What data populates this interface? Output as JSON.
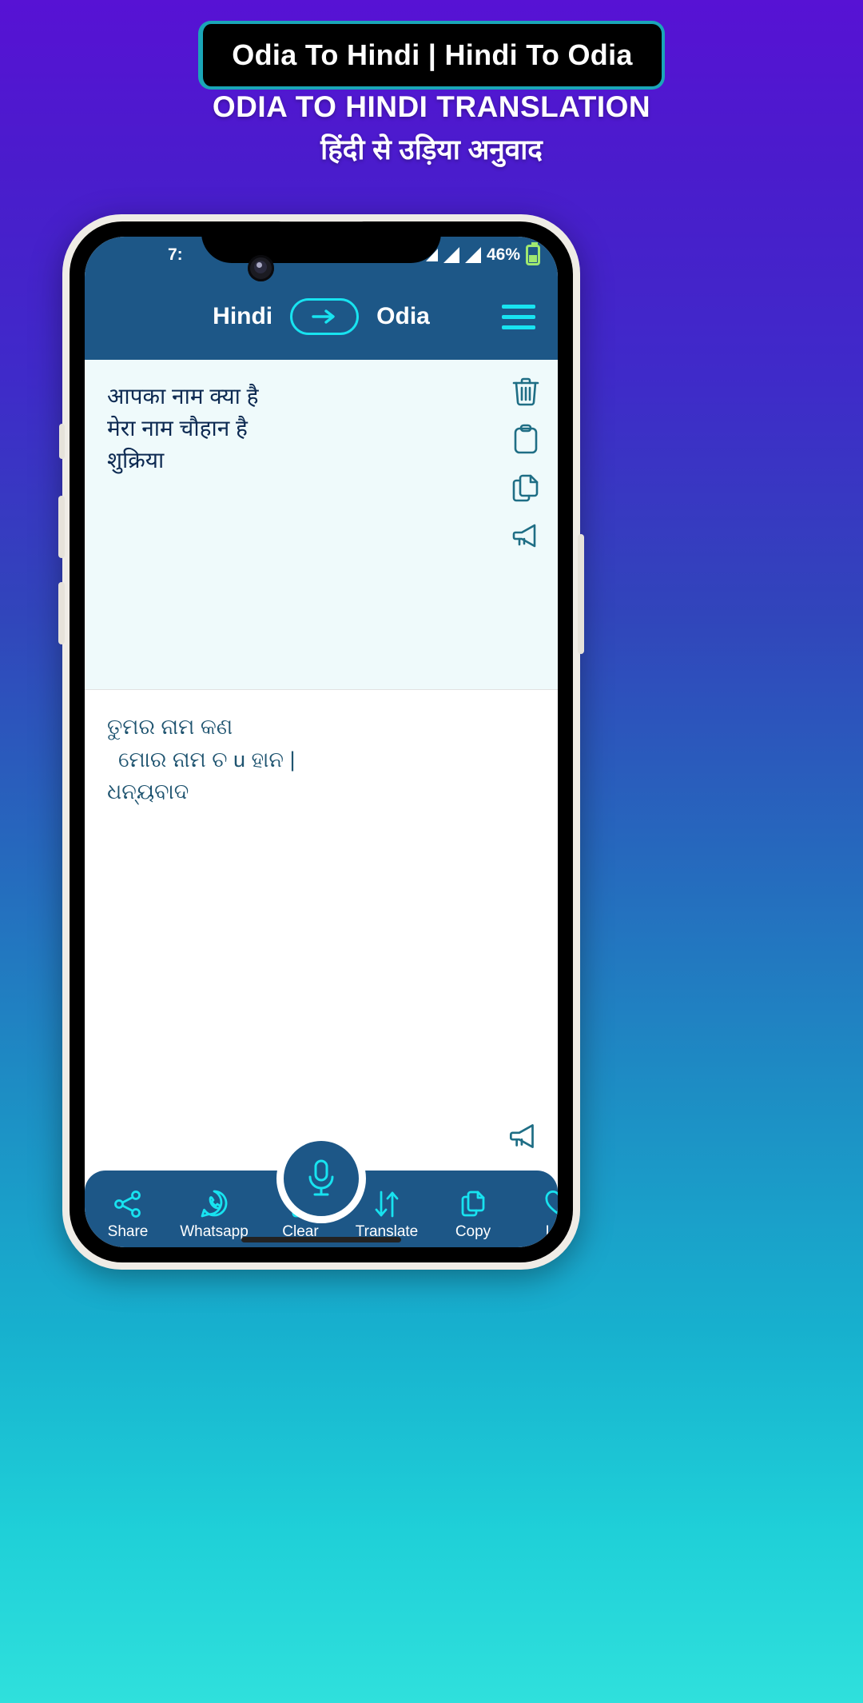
{
  "promo": {
    "badge_title": "Odia To Hindi | Hindi To Odia",
    "headline": "ODIA TO HINDI TRANSLATION",
    "subheadline": "हिंदी से उड़िया अनुवाद",
    "accent_color": "#1aa6b8",
    "background_top": "#5712d4",
    "background_bottom": "#2fe0dc"
  },
  "phone": {
    "status_bar": {
      "time": "7:",
      "battery_text": "46%",
      "signal_icon": "signal-bars-icon",
      "battery_icon": "battery-icon",
      "background": "#1d5787"
    },
    "app_bar": {
      "source_language": "Hindi",
      "target_language": "Odia",
      "swap_icon": "arrow-right-icon",
      "menu_icon": "hamburger-menu-icon",
      "accent_color": "#18e3f0"
    },
    "input_pane": {
      "lines": [
        "आपका नाम क्या है",
        "मेरा नाम चौहान है",
        "शुक्रिया"
      ],
      "tools": [
        {
          "name": "delete-icon",
          "label": "Delete"
        },
        {
          "name": "paste-icon",
          "label": "Paste"
        },
        {
          "name": "copy-icon",
          "label": "Copy"
        },
        {
          "name": "speak-icon",
          "label": "Speak"
        }
      ],
      "background": "#effafb",
      "text_color": "#0d2a52"
    },
    "output_pane": {
      "lines": [
        "ତୁମର ନାମ କଣ",
        "ମୋର ନାମ ଚ u ହାନ |",
        "ଧନ୍ୟବାଦ"
      ],
      "speak_icon": "speak-icon",
      "background": "#ffffff",
      "text_color": "#1f5470"
    },
    "bottom_nav": {
      "left_items": [
        {
          "label": "Share",
          "icon": "share-icon"
        },
        {
          "label": "Whatsapp",
          "icon": "whatsapp-icon"
        },
        {
          "label": "Clear",
          "icon": "trash-icon"
        }
      ],
      "right_items": [
        {
          "label": "Translate",
          "icon": "translate-swap-icon"
        },
        {
          "label": "Copy",
          "icon": "copy-icon"
        },
        {
          "label": "Like",
          "icon": "heart-icon"
        }
      ],
      "mic_icon": "microphone-icon",
      "background": "#1d5787",
      "icon_color": "#18e3f0"
    }
  }
}
